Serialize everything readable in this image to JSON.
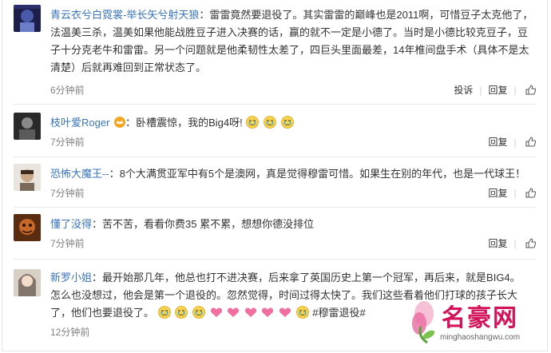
{
  "comments": [
    {
      "username": "青云衣兮白霓裳-举长矢兮射天狼",
      "text": "雷雷竟然要退役了。其实雷雷的巅峰也是2011啊，可惜豆子太克他了，法温美三杀，温美如果他能战胜豆子进入决赛的话，赢的就不一定是小德了。当时是小德比较克豆子，豆子十分克老牛和雷雷。另一个问题就是他柔韧性太差了，四巨头里面最差，14年椎间盘手术（具体不是太清楚）后就再难回到正常状态了。",
      "time": "6分钟前",
      "actions": [
        "投诉",
        "回复",
        "赞"
      ]
    },
    {
      "username": "枝叶爱Roger",
      "text": "卧槽震惊，我的Big4呀!",
      "time": "7分钟前",
      "actions": [
        "回复",
        "赞"
      ]
    },
    {
      "username": "恐怖大魔王--",
      "text": "8个大满贯亚军中有5个是澳网，真是觉得穆雷可惜。如果生在别的年代，也是一代球王！",
      "time": "7分钟前",
      "actions": [
        "回复",
        "赞"
      ]
    },
    {
      "username": "懂了没得",
      "text": "苦不苦，看看你费35 累不累，想想你德没排位",
      "time": "7分钟前",
      "actions": [
        "回复",
        "赞"
      ]
    },
    {
      "username": "新罗小姐",
      "text": "最开始那几年，他总也打不进决赛，后来拿了英国历史上第一个冠军，再后来，就是BIG4。怎么也没想过，他会是第一个退役的。忽然觉得，时间过得太快了。我们这些看着他们打球的孩子长大了，他们也要退役了。",
      "hashtag": "#穆雷退役#",
      "time": "12分钟前",
      "actions": []
    }
  ],
  "watermark": {
    "title": "名豪网",
    "url": "minghaoshangwu.com"
  },
  "colors": {
    "username": "#3b74b8",
    "timestamp": "#808080",
    "watermark": "#d4145a"
  },
  "icons": [
    "crown-icon",
    "crying-emoji",
    "heart-emoji",
    "like-icon"
  ]
}
